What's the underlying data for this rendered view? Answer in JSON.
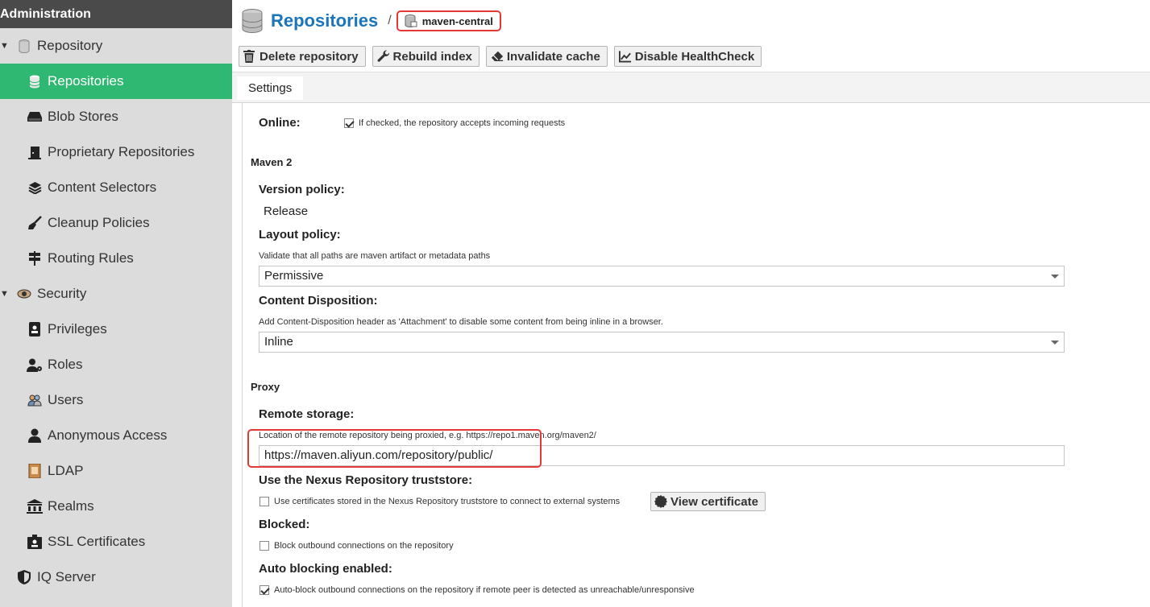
{
  "sidebar": {
    "header": "Administration",
    "items": [
      {
        "label": "Repository",
        "icon": "database-icon",
        "type": "group"
      },
      {
        "label": "Repositories",
        "icon": "database-icon",
        "type": "child",
        "active": true
      },
      {
        "label": "Blob Stores",
        "icon": "hard-drive-icon",
        "type": "child"
      },
      {
        "label": "Proprietary Repositories",
        "icon": "door-icon",
        "type": "child"
      },
      {
        "label": "Content Selectors",
        "icon": "layers-icon",
        "type": "child"
      },
      {
        "label": "Cleanup Policies",
        "icon": "broom-icon",
        "type": "child"
      },
      {
        "label": "Routing Rules",
        "icon": "signpost-icon",
        "type": "child"
      },
      {
        "label": "Security",
        "icon": "eye-icon",
        "type": "group"
      },
      {
        "label": "Privileges",
        "icon": "id-badge-icon",
        "type": "child"
      },
      {
        "label": "Roles",
        "icon": "user-gear-icon",
        "type": "child"
      },
      {
        "label": "Users",
        "icon": "users-icon",
        "type": "child"
      },
      {
        "label": "Anonymous Access",
        "icon": "user-icon",
        "type": "child"
      },
      {
        "label": "LDAP",
        "icon": "address-book-icon",
        "type": "child"
      },
      {
        "label": "Realms",
        "icon": "building-icon",
        "type": "child"
      },
      {
        "label": "SSL Certificates",
        "icon": "id-card-icon",
        "type": "child"
      },
      {
        "label": "IQ Server",
        "icon": "shield-icon",
        "type": "group-noncaret"
      }
    ]
  },
  "header": {
    "title": "Repositories",
    "separator": "/",
    "breadcrumb": "maven-central"
  },
  "toolbar": {
    "delete": "Delete repository",
    "rebuild": "Rebuild index",
    "invalidate": "Invalidate cache",
    "disable_health": "Disable HealthCheck"
  },
  "tabs": {
    "settings": "Settings"
  },
  "form": {
    "online_label": "Online:",
    "online_help": "If checked, the repository accepts incoming requests",
    "online_checked": true,
    "maven_section": "Maven 2",
    "version_policy_label": "Version policy:",
    "version_policy_value": "Release",
    "layout_policy_label": "Layout policy:",
    "layout_policy_help": "Validate that all paths are maven artifact or metadata paths",
    "layout_policy_value": "Permissive",
    "content_disposition_label": "Content Disposition:",
    "content_disposition_help": "Add Content-Disposition header as 'Attachment' to disable some content from being inline in a browser.",
    "content_disposition_value": "Inline",
    "proxy_section": "Proxy",
    "remote_storage_label": "Remote storage:",
    "remote_storage_help": "Location of the remote repository being proxied, e.g. https://repo1.maven.org/maven2/",
    "remote_storage_value": "https://maven.aliyun.com/repository/public/",
    "truststore_label": "Use the Nexus Repository truststore:",
    "truststore_help": "Use certificates stored in the Nexus Repository truststore to connect to external systems",
    "truststore_checked": false,
    "view_certificate": "View certificate",
    "blocked_label": "Blocked:",
    "blocked_help": "Block outbound connections on the repository",
    "blocked_checked": false,
    "auto_block_label": "Auto blocking enabled:",
    "auto_block_help": "Auto-block outbound connections on the repository if remote peer is detected as unreachable/unresponsive",
    "auto_block_checked": true
  },
  "colors": {
    "active_nav": "#2eb872",
    "title_blue": "#1b75bb",
    "highlight_red": "#e53935"
  }
}
